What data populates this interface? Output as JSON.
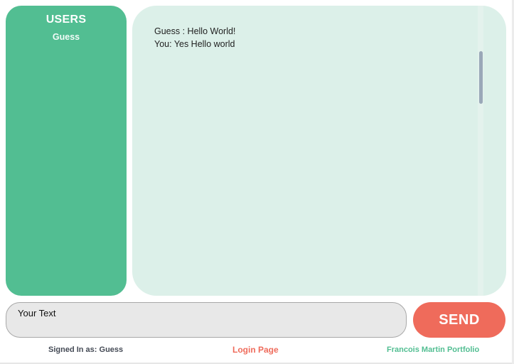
{
  "users_panel": {
    "title": "USERS",
    "users": [
      "Guess"
    ]
  },
  "chat": {
    "messages": [
      {
        "text": "Guess : Hello World!"
      },
      {
        "text": "You: Yes Hello world"
      }
    ]
  },
  "composer": {
    "placeholder": "Your Text",
    "send_label": "SEND"
  },
  "footer": {
    "signed_in": "Signed In as: Guess",
    "login_link": "Login Page",
    "portfolio_link": "Francois Martin Portfolio"
  },
  "colors": {
    "users_panel_bg": "#52be92",
    "chat_bg": "#dcf0e9",
    "send_button": "#ef6b5b",
    "login_link": "#ef6b5b",
    "portfolio_link": "#52be92"
  }
}
